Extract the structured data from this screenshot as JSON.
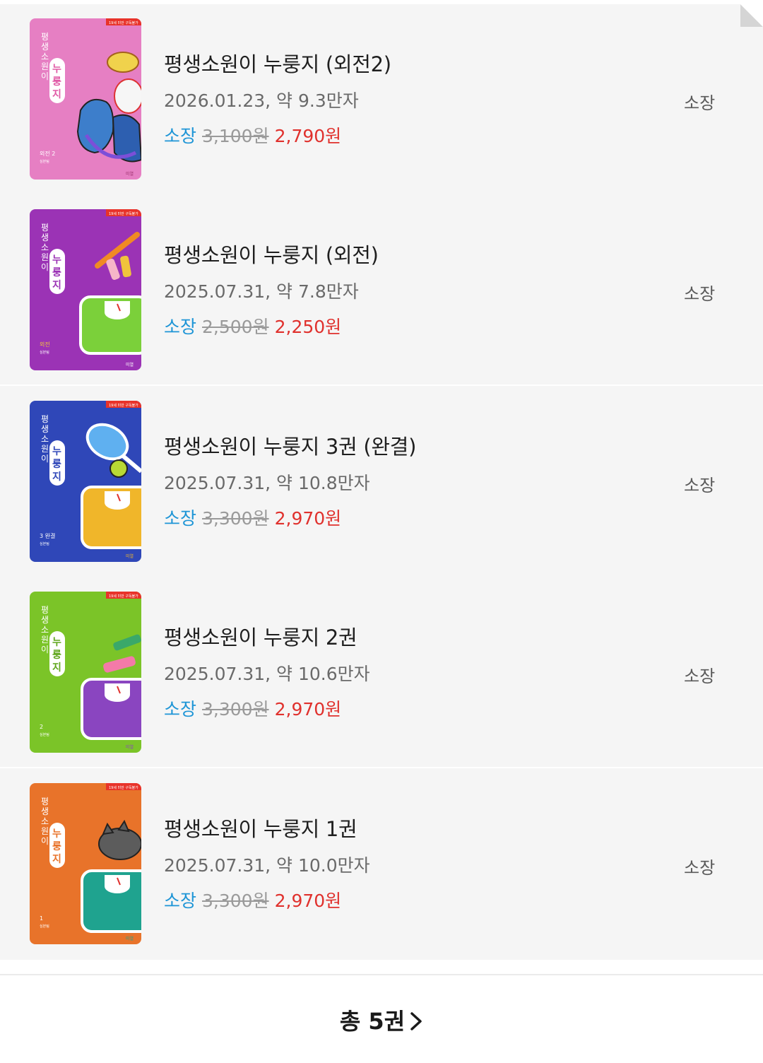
{
  "books": [
    {
      "title": "평생소원이 누룽지 (외전2)",
      "meta": "2026.01.23, 약 9.3만자",
      "price_type": "소장",
      "price_original": "3,100원",
      "price_sale": "2,790원",
      "own_label": "소장",
      "cover": {
        "bg": "#e67fc3",
        "series": "평생소원이",
        "name": "누룽지",
        "volume": "외전 2",
        "age_badge": "19세 미만 구독불가",
        "image": "sneakers-icon"
      }
    },
    {
      "title": "평생소원이 누룽지 (외전)",
      "meta": "2025.07.31, 약 7.8만자",
      "price_type": "소장",
      "price_original": "2,500원",
      "price_sale": "2,250원",
      "own_label": "소장",
      "cover": {
        "bg": "#9b33b5",
        "series": "평생소원이",
        "name": "누룽지",
        "volume": "외전",
        "age_badge": "19세 미만 구독불가",
        "image": "paint-scale-icon"
      }
    },
    {
      "title": "평생소원이 누룽지 3권 (완결)",
      "meta": "2025.07.31, 약 10.8만자",
      "price_type": "소장",
      "price_original": "3,300원",
      "price_sale": "2,970원",
      "own_label": "소장",
      "cover": {
        "bg": "#2f47b8",
        "series": "평생소원이",
        "name": "누룽지",
        "volume": "3 완결",
        "age_badge": "19세 미만 구독불가",
        "image": "tennis-scale-icon"
      }
    },
    {
      "title": "평생소원이 누룽지 2권",
      "meta": "2025.07.31, 약 10.6만자",
      "price_type": "소장",
      "price_original": "3,300원",
      "price_sale": "2,970원",
      "own_label": "소장",
      "cover": {
        "bg": "#7bc428",
        "series": "평생소원이",
        "name": "누룽지",
        "volume": "2",
        "age_badge": "19세 미만 구독불가",
        "image": "dumbbell-scale-icon"
      }
    },
    {
      "title": "평생소원이 누룽지 1권",
      "meta": "2025.07.31, 약 10.0만자",
      "price_type": "소장",
      "price_original": "3,300원",
      "price_sale": "2,970원",
      "own_label": "소장",
      "cover": {
        "bg": "#e8732a",
        "series": "평생소원이",
        "name": "누룽지",
        "volume": "1",
        "age_badge": "19세 미만 구독불가",
        "image": "cat-scale-icon"
      }
    }
  ],
  "footer": {
    "total_label": "총 5권"
  }
}
